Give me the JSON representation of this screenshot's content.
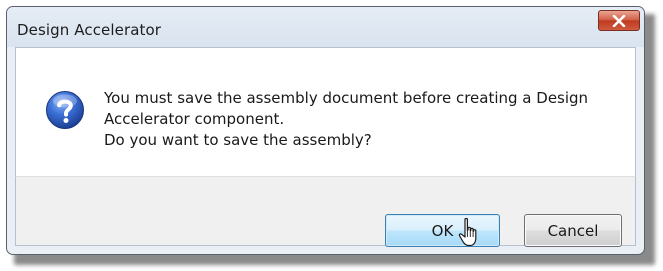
{
  "window": {
    "title": "Design Accelerator"
  },
  "message": {
    "line1": "You must save the assembly document before creating a Design",
    "line2": "Accelerator component.",
    "line3": "Do you want to save the assembly?"
  },
  "buttons": {
    "ok_label": "OK",
    "cancel_label": "Cancel"
  },
  "icons": {
    "message_icon": "question-icon",
    "close_icon": "close-icon",
    "pointer": "mouse-cursor-icon"
  },
  "colors": {
    "close_button": "#c9462c",
    "question_icon": "#2a5cc4",
    "default_button_border": "#3c7fb1"
  }
}
